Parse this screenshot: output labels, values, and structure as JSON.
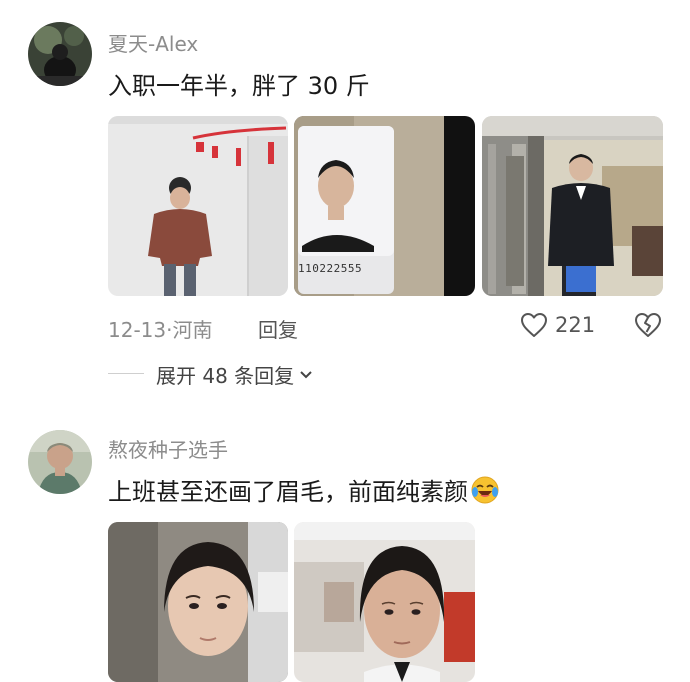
{
  "comments": [
    {
      "username": "夏天-Alex",
      "text": "入职一年半，胖了 30 斤",
      "photos": [
        {
          "name": "photo-before-room"
        },
        {
          "name": "photo-id-card",
          "card_number": "110222555"
        },
        {
          "name": "photo-suit-building"
        }
      ],
      "date_location": "12-13·河南",
      "reply_label": "回复",
      "like_count": "221",
      "expand_label": "展开 48 条回复"
    },
    {
      "username": "熬夜种子选手",
      "text": "上班甚至还画了眉毛，前面纯素颜",
      "emoji": "laughing-crying-face",
      "photos": [
        {
          "name": "photo-girl-1"
        },
        {
          "name": "photo-girl-2"
        }
      ]
    }
  ],
  "icons": {
    "like": "heart-outline-icon",
    "dislike": "broken-heart-icon",
    "expand": "chevron-down-icon"
  },
  "colors": {
    "text_primary": "#1a1a1a",
    "text_secondary": "#8c8c8c",
    "background": "#ffffff"
  }
}
